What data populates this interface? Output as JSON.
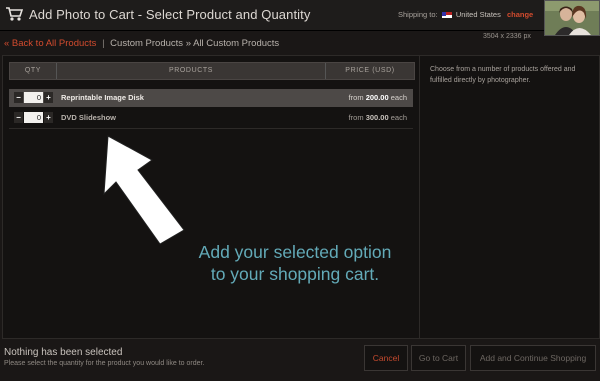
{
  "header": {
    "title": "Add Photo to Cart - Select Product and Quantity",
    "shipping_label": "Shipping to:",
    "shipping_country": "United States",
    "change_link": "change",
    "image_dimensions": "3504 x 2336 px"
  },
  "breadcrumb": {
    "back": "« Back to All Products",
    "separator": "|",
    "items": [
      "Custom Products",
      "»",
      "All Custom Products"
    ]
  },
  "table": {
    "headers": {
      "qty": "QTY",
      "products": "PRODUCTS",
      "price": "PRICE (USD)"
    },
    "rows": [
      {
        "qty": "0",
        "minus": "−",
        "plus": "+",
        "product": "Reprintable Image Disk",
        "price_prefix": "from",
        "price": "200.00",
        "price_suffix": "each"
      },
      {
        "qty": "0",
        "minus": "−",
        "plus": "+",
        "product": "DVD Slideshow",
        "price_prefix": "from",
        "price": "300.00",
        "price_suffix": "each"
      }
    ]
  },
  "side_note": "Choose from a number of products offered and fulfilled directly by photographer.",
  "callout": {
    "line1": "Add your selected option",
    "line2": "to your shopping cart."
  },
  "footer": {
    "status": "Nothing has been selected",
    "hint": "Please select the quantity for the product you would like to order.",
    "cancel": "Cancel",
    "go_to_cart": "Go to Cart",
    "add_continue": "Add and Continue Shopping"
  },
  "colors": {
    "accent": "#d24b2e",
    "callout": "#63aab8",
    "background": "#1a1716",
    "selected_row": "#4d4947"
  },
  "icons": [
    "cart-icon",
    "us-flag-icon",
    "pointer-arrow-icon"
  ]
}
